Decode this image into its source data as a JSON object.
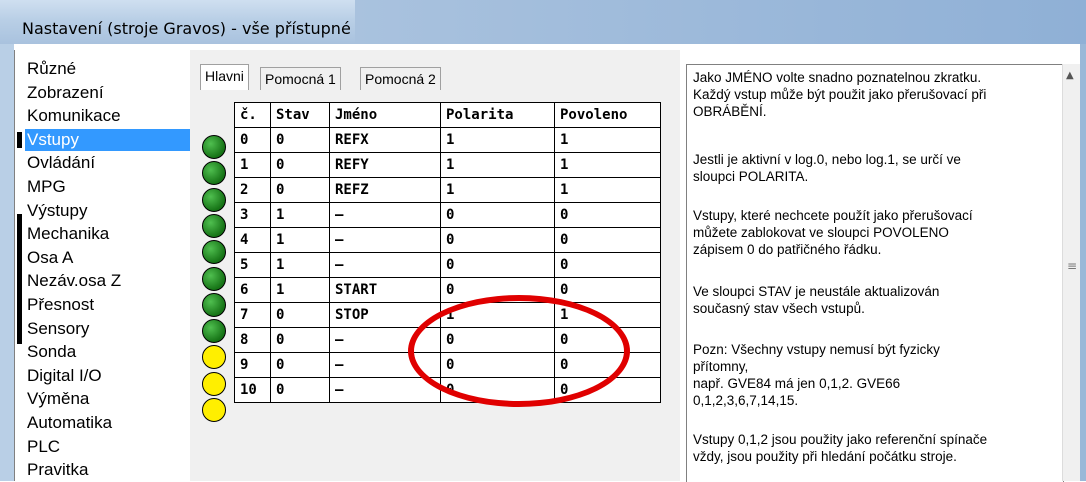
{
  "window": {
    "title": "Nastavení (stroje Gravos) - vše přístupné"
  },
  "sidebar": {
    "items": [
      {
        "label": "Různé"
      },
      {
        "label": "Zobrazení"
      },
      {
        "label": "Komunikace"
      },
      {
        "label": "Vstupy",
        "selected": true
      },
      {
        "label": "Ovládání"
      },
      {
        "label": "MPG"
      },
      {
        "label": "Výstupy"
      },
      {
        "label": "Mechanika"
      },
      {
        "label": "Osa A"
      },
      {
        "label": "Nezáv.osa Z"
      },
      {
        "label": "Přesnost"
      },
      {
        "label": "Sensory"
      },
      {
        "label": "Sonda"
      },
      {
        "label": "Digital I/O"
      },
      {
        "label": "Výměna"
      },
      {
        "label": "Automatika"
      },
      {
        "label": "PLC"
      },
      {
        "label": "Pravitka"
      }
    ]
  },
  "tabs": [
    {
      "label": "Hlavni",
      "active": true
    },
    {
      "label": "Pomocná 1"
    },
    {
      "label": "Pomocná 2"
    }
  ],
  "table": {
    "headers": [
      "č.",
      "Stav",
      "Jméno",
      "Polarita",
      "Povoleno"
    ],
    "rows": [
      {
        "led": "green",
        "cells": [
          "0",
          "0",
          "REFX",
          "1",
          "1"
        ]
      },
      {
        "led": "green",
        "cells": [
          "1",
          "0",
          "REFY",
          "1",
          "1"
        ]
      },
      {
        "led": "green",
        "cells": [
          "2",
          "0",
          "REFZ",
          "1",
          "1"
        ]
      },
      {
        "led": "green",
        "cells": [
          "3",
          "1",
          "–",
          "0",
          "0"
        ]
      },
      {
        "led": "green",
        "cells": [
          "4",
          "1",
          "–",
          "0",
          "0"
        ]
      },
      {
        "led": "green",
        "cells": [
          "5",
          "1",
          "–",
          "0",
          "0"
        ]
      },
      {
        "led": "green",
        "cells": [
          "6",
          "1",
          "START",
          "0",
          "0"
        ]
      },
      {
        "led": "green",
        "cells": [
          "7",
          "0",
          "STOP",
          "1",
          "1"
        ]
      },
      {
        "led": "yellow",
        "cells": [
          "8",
          "0",
          "–",
          "0",
          "0"
        ]
      },
      {
        "led": "yellow",
        "cells": [
          "9",
          "0",
          "–",
          "0",
          "0"
        ]
      },
      {
        "led": "yellow",
        "cells": [
          "10",
          "0",
          "–",
          "0",
          "0"
        ]
      }
    ]
  },
  "help": {
    "paragraphs": [
      "Jako JMÉNO volte snadno poznatelnou zkratku.\nKaždý vstup může být použit jako přerušovací při\nOBRÁBĚNÍ.",
      "Jestli je aktivní v log.0, nebo log.1, se určí ve\nsloupci POLARITA.",
      "Vstupy, které nechcete použít jako přerušovací\nmůžete zablokovat ve sloupci POVOLENO\nzápisem 0 do patřičného řádku.",
      "Ve sloupci STAV je neustále aktualizován\nsoučasný stav všech vstupů.",
      "Pozn: Všechny vstupy nemusí být fyzicky\npřítomny,\nnapř. GVE84 má jen 0,1,2. GVE66\n0,1,2,3,6,7,14,15.",
      "Vstupy 0,1,2 jsou použity jako referenční spínače\nvždy, jsou použity při hledání počátku stroje."
    ]
  },
  "colors": {
    "selection": "#3399ff",
    "led_green": "#1e8a1e",
    "led_yellow": "#ffef00",
    "annotation": "#e00000"
  }
}
